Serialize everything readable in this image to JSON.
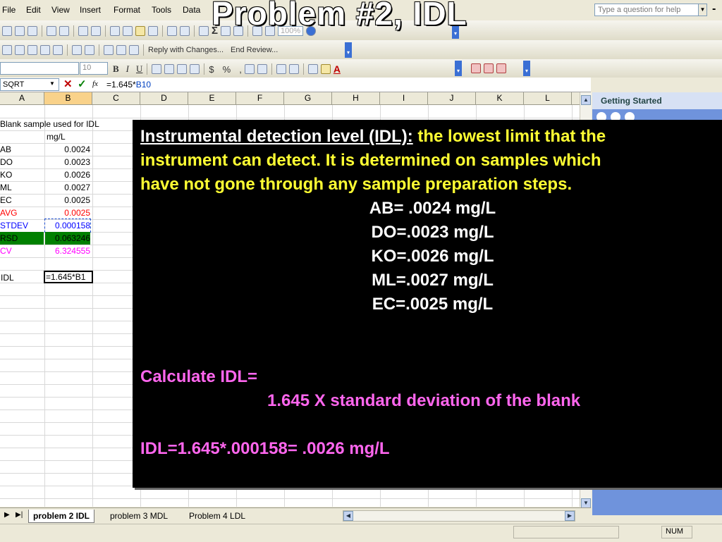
{
  "slide": {
    "title": "Problem #2, IDL"
  },
  "menu": {
    "items": [
      "File",
      "Edit",
      "View",
      "Insert",
      "Format",
      "Tools",
      "Data"
    ]
  },
  "help": {
    "placeholder": "Type a question for help"
  },
  "toolbar": {
    "zoom": "100%",
    "reply_with_changes": "Reply with Changes...",
    "end_review": "End Review...",
    "font_size": "10",
    "bold": "B",
    "italic": "I",
    "underline": "U",
    "currency": "$",
    "percent": "%",
    "comma": ","
  },
  "formula_bar": {
    "name_box": "SQRT",
    "formula_prefix": "=1.645*",
    "formula_ref": "B10"
  },
  "columns": [
    "A",
    "B",
    "C",
    "D",
    "E",
    "F",
    "G",
    "H",
    "I",
    "J",
    "K",
    "L"
  ],
  "sheet": {
    "header_row1": "Blank sample used for IDL",
    "header_row2": "mg/L",
    "rows": [
      {
        "label": "AB",
        "value": "0.0024",
        "color": "#000000"
      },
      {
        "label": "DO",
        "value": "0.0023",
        "color": "#000000"
      },
      {
        "label": "KO",
        "value": "0.0026",
        "color": "#000000"
      },
      {
        "label": "ML",
        "value": "0.0027",
        "color": "#000000"
      },
      {
        "label": "EC",
        "value": "0.0025",
        "color": "#000000"
      },
      {
        "label": "AVG",
        "value": "0.0025",
        "color": "#ff0000"
      },
      {
        "label": "STDEV",
        "value": "0.000158",
        "color": "#0000ff"
      },
      {
        "label": "RSD",
        "value": "0.063246",
        "color": "#000000",
        "fill": "#008000"
      },
      {
        "label": "CV",
        "value": "6.324555",
        "color": "#ff00ff"
      }
    ],
    "idl_label": "IDL",
    "idl_formula": "=1.645*B1"
  },
  "task_pane": {
    "title": "Getting Started"
  },
  "tabs": [
    "problem 2 IDL",
    "problem 3 MDL",
    "Problem 4 LDL"
  ],
  "status": {
    "num": "NUM"
  },
  "overlay": {
    "heading": "Instrumental detection level (IDL):",
    "def_1": " the lowest limit that the",
    "def_2": "instrument can detect. It is determined on samples which",
    "def_3": "have not gone through any sample preparation steps.",
    "values": [
      "AB= .0024 mg/L",
      "DO=.0023 mg/L",
      "KO=.0026 mg/L",
      "ML=.0027 mg/L",
      "EC=.0025 mg/L"
    ],
    "calc_label": "Calculate IDL=",
    "calc_formula": "1.645 X standard deviation of the blank",
    "result": "IDL=1.645*.000158= .0026 mg/L"
  },
  "colors": {
    "overlay_bg": "#000000",
    "definition": "#ffff33",
    "calc": "#ff66ee",
    "task_pane": "#6f93dc"
  }
}
